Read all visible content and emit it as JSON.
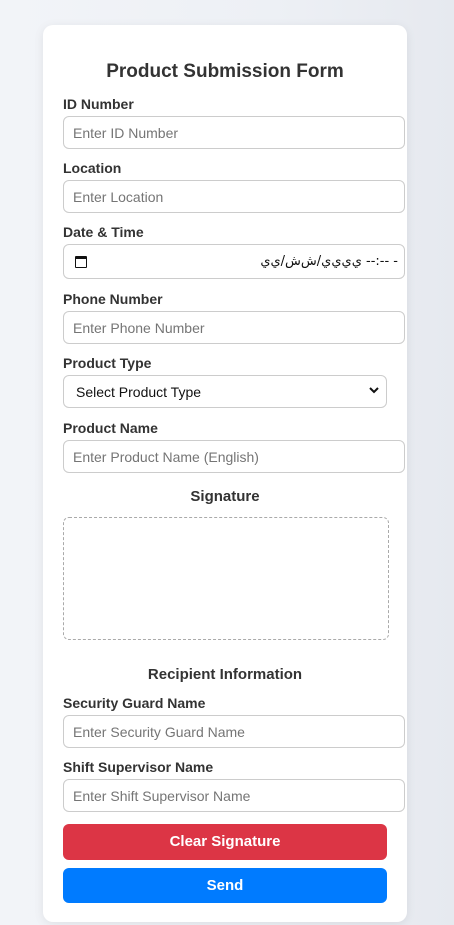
{
  "form": {
    "title": "Product Submission Form",
    "id_number": {
      "label": "ID Number",
      "placeholder": "Enter ID Number"
    },
    "location": {
      "label": "Location",
      "placeholder": "Enter Location"
    },
    "date_time": {
      "label": "Date & Time",
      "value_text": "ي‌ي‌ي‌ي/ش‌ش/ي‌ي  --:-- -"
    },
    "phone_number": {
      "label": "Phone Number",
      "placeholder": "Enter Phone Number"
    },
    "product_type": {
      "label": "Product Type",
      "selected": "Select Product Type"
    },
    "product_name": {
      "label": "Product Name",
      "placeholder": "Enter Product Name (English)"
    }
  },
  "signature": {
    "title": "Signature"
  },
  "recipient": {
    "title": "Recipient Information",
    "security_guard": {
      "label": "Security Guard Name",
      "placeholder": "Enter Security Guard Name"
    },
    "shift_supervisor": {
      "label": "Shift Supervisor Name",
      "placeholder": "Enter Shift Supervisor Name"
    }
  },
  "buttons": {
    "clear_signature": "Clear Signature",
    "send": "Send"
  },
  "colors": {
    "clear_button": "#dc3545",
    "send_button": "#007bff",
    "text": "#333333",
    "border": "#cccccc"
  },
  "icons": [
    "calendar-icon",
    "chevron-down-icon"
  ]
}
